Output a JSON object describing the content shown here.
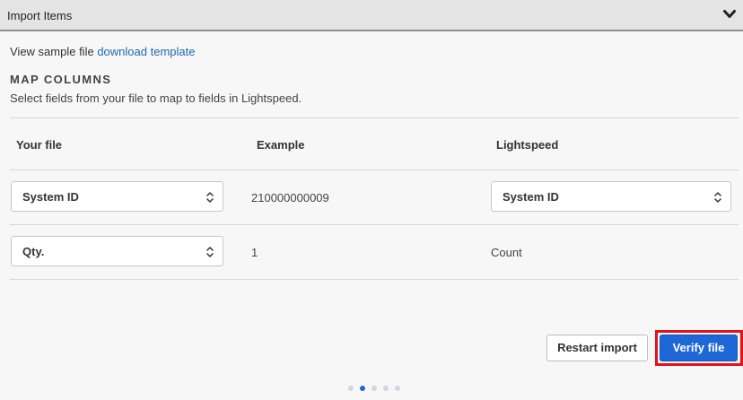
{
  "header": {
    "title": "Import Items",
    "collapse_icon": "chevron-down-icon"
  },
  "sample": {
    "prefix": "View sample file",
    "link_label": "download template"
  },
  "section": {
    "title": "MAP COLUMNS",
    "description": "Select fields from your file to map to fields in Lightspeed."
  },
  "table": {
    "headers": [
      "Your file",
      "Example",
      "Lightspeed"
    ],
    "rows": [
      {
        "your_file": "System ID",
        "example": "210000000009",
        "lightspeed": "System ID",
        "lightspeed_is_select": true
      },
      {
        "your_file": "Qty.",
        "example": "1",
        "lightspeed": "Count",
        "lightspeed_is_select": false
      }
    ]
  },
  "actions": {
    "restart_label": "Restart import",
    "verify_label": "Verify file",
    "highlight_color": "#e3111c",
    "primary_color": "#1e67d6"
  },
  "pager": {
    "total_steps": 5,
    "current_step": 2
  }
}
